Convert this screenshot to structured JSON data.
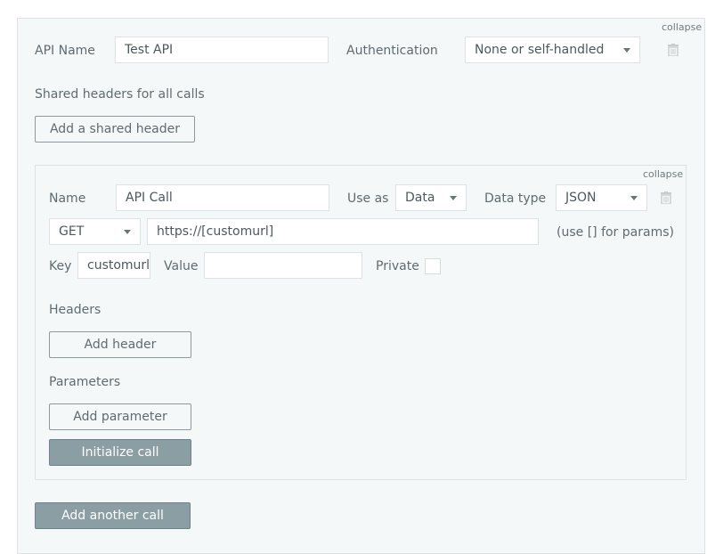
{
  "api": {
    "collapse": "collapse",
    "name_label": "API Name",
    "name_value": "Test API",
    "auth_label": "Authentication",
    "auth_value": "None or self-handled",
    "shared_headers_label": "Shared headers for all calls",
    "add_shared_header": "Add a shared header",
    "add_another_call": "Add another call"
  },
  "call": {
    "collapse": "collapse",
    "name_label": "Name",
    "name_value": "API Call",
    "use_as_label": "Use as",
    "use_as_value": "Data",
    "data_type_label": "Data type",
    "data_type_value": "JSON",
    "method": "GET",
    "url": "https://[customurl]",
    "url_hint": "(use [] for params)",
    "key_label": "Key",
    "key_value": "customurl",
    "value_label": "Value",
    "value_value": "",
    "private_label": "Private",
    "headers_label": "Headers",
    "add_header": "Add header",
    "parameters_label": "Parameters",
    "add_parameter": "Add parameter",
    "initialize": "Initialize call"
  }
}
